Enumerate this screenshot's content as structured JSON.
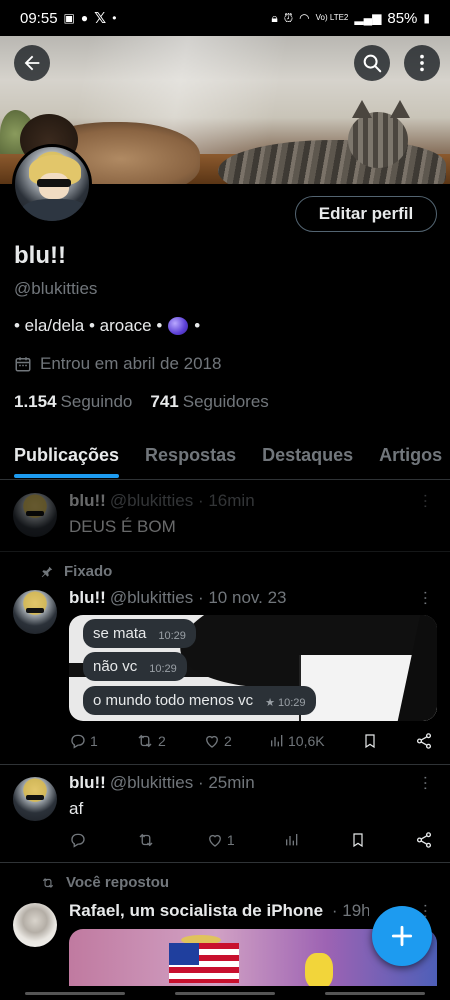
{
  "status_bar": {
    "time": "09:55",
    "battery": "85%",
    "carrier": "Vo) LTE2"
  },
  "profile": {
    "name": "blu!!",
    "handle": "@blukitties",
    "bio_left": "• ela/dela • aroace •",
    "bio_right": "•",
    "joined": "Entrou em abril de 2018",
    "following_count": "1.154",
    "following_label": "Seguindo",
    "followers_count": "741",
    "followers_label": "Seguidores",
    "edit_label": "Editar perfil"
  },
  "tabs": [
    "Publicações",
    "Respostas",
    "Destaques",
    "Artigos"
  ],
  "posts": [
    {
      "name": "blu!!",
      "handle": "@blukitties",
      "time": "· 16min",
      "text": "DEUS É BOM"
    },
    {
      "pinned_label": "Fixado",
      "name": "blu!!",
      "handle": "@blukitties",
      "time": "· 10 nov. 23",
      "bubbles": [
        {
          "text": "se mata",
          "time": "10:29"
        },
        {
          "text": "não vc",
          "time": "10:29"
        },
        {
          "text": "o mundo todo menos vc",
          "time": "★ 10:29"
        }
      ],
      "replies": "1",
      "reposts": "2",
      "likes": "2",
      "views": "10,6K"
    },
    {
      "name": "blu!!",
      "handle": "@blukitties",
      "time": "· 25min",
      "text": "af",
      "likes": "1"
    },
    {
      "repost_label": "Você repostou",
      "name": "Rafael, um socialista de iPhone",
      "time": "· 19h"
    }
  ],
  "colors": {
    "accent": "#1d9bf0",
    "muted": "#71767b",
    "text": "#e7e9ea",
    "background": "#000000"
  }
}
